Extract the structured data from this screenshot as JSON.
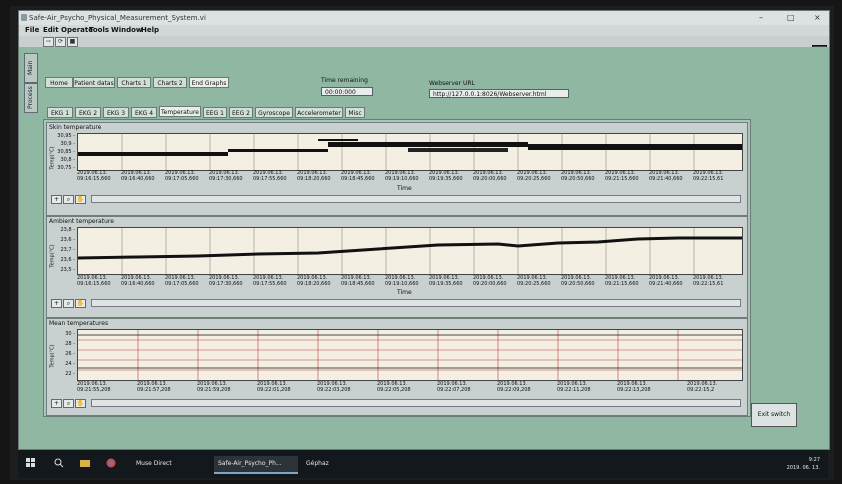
{
  "window": {
    "title": "Safe-Air_Psycho_Physical_Measurement_System.vi",
    "controls": [
      "–",
      "□",
      "×"
    ]
  },
  "menu": [
    "File",
    "Edit",
    "Operate",
    "Tools",
    "Window",
    "Help"
  ],
  "side_tabs": [
    "Main",
    "Process"
  ],
  "top_tabs": [
    "Home",
    "Patient datas",
    "Charts 1",
    "Charts 2",
    "End Graphs"
  ],
  "time_remaining": {
    "label": "Time remaining",
    "value": "00:00:000"
  },
  "webserver": {
    "label": "Webserver URL",
    "value": "http://127.0.0.1:8026/Webserver.html"
  },
  "sub_tabs": [
    "EKG 1",
    "EKG 2",
    "EKG 3",
    "EKG 4",
    "Temperature",
    "EEG 1",
    "EEG 2",
    "Gyroscope",
    "Accelerometer",
    "Misc"
  ],
  "active_sub_tab": "Temperature",
  "charts": [
    {
      "title": "Skin temperature",
      "ylabel": "Temp(°C)",
      "yticks": [
        "30,95 -",
        "30,9 -",
        "30,85 -",
        "30,8 -",
        "30,75 -"
      ],
      "date_label": "2019.06.13.",
      "xtimes": [
        "09:16:15,660",
        "09:16:40,660",
        "09:17:05,660",
        "09:17:30,660",
        "09:17:55,660",
        "09:18:20,660",
        "09:18:45,660",
        "09:19:10,660",
        "09:19:35,660",
        "09:20:00,660",
        "09:20:25,660",
        "09:20:50,660",
        "09:21:15,660",
        "09:21:40,660",
        "09:22:15,61"
      ],
      "xlabel": "Time"
    },
    {
      "title": "Ambient temperature",
      "ylabel": "Temp(°C)",
      "yticks": [
        "23,8 -",
        "23,6 -",
        "23,7 -",
        "23,6 -",
        "23,5 -"
      ],
      "date_label": "2019.06.13.",
      "xtimes": [
        "09:16:15,660",
        "09:16:40,660",
        "09:17:05,660",
        "09:17:30,660",
        "09:17:55,660",
        "09:18:20,660",
        "09:18:45,660",
        "09:19:10,660",
        "09:19:35,660",
        "09:20:00,660",
        "09:20:25,660",
        "09:20:50,660",
        "09:21:15,660",
        "09:21:40,660",
        "09:22:15,61"
      ],
      "xlabel": "Time"
    },
    {
      "title": "Mean temperatures",
      "ylabel": "Temp(°C)",
      "yticks": [
        "30 -",
        "28 -",
        "26 -",
        "24 -",
        "22 -"
      ],
      "date_label": "2019.06.13.",
      "xtimes": [
        "09:21:55,208",
        "09:21:57,208",
        "09:21:59,208",
        "09:22:01,208",
        "09:22:03,208",
        "09:22:05,208",
        "09:22:07,208",
        "09:22:09,208",
        "09:22:11,208",
        "09:22:13,208",
        "09:22:15,2"
      ],
      "xlabel": ""
    }
  ],
  "exit_button": "Exit switch",
  "taskbar": {
    "apps": [
      "Muse Direct",
      "Safe-Air_Psycho_Ph...",
      "Géphaz"
    ],
    "time": "9:27",
    "date": "2019. 06. 13."
  },
  "colors": {
    "panel_bg": "#8fb7a2",
    "plot_bg": "#f3f0e3",
    "grid_line": "#c43b3b",
    "trace": "#111111"
  }
}
